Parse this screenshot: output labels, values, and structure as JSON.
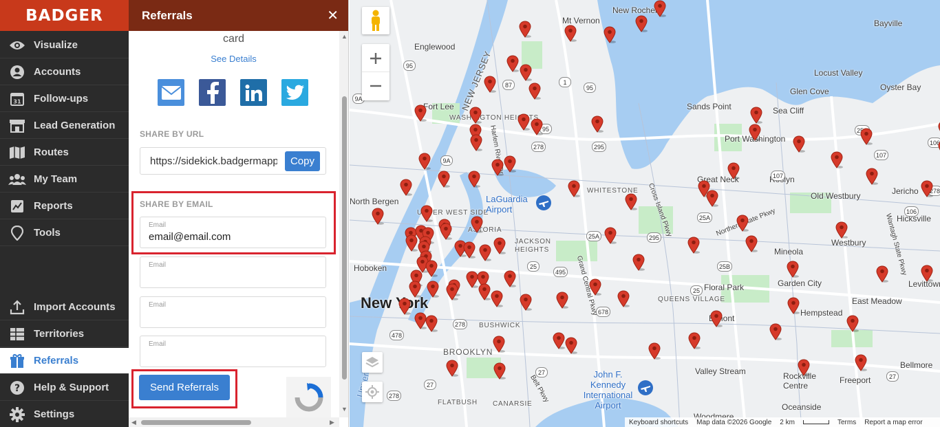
{
  "app": {
    "logo": "BADGER"
  },
  "sidebar": {
    "items": [
      {
        "label": "Visualize",
        "icon": "eye-icon"
      },
      {
        "label": "Accounts",
        "icon": "person-icon"
      },
      {
        "label": "Follow-ups",
        "icon": "calendar-icon"
      },
      {
        "label": "Lead Generation",
        "icon": "store-icon"
      },
      {
        "label": "Routes",
        "icon": "map-icon"
      },
      {
        "label": "My Team",
        "icon": "team-icon"
      },
      {
        "label": "Reports",
        "icon": "chart-icon"
      },
      {
        "label": "Tools",
        "icon": "pin-outline-icon"
      }
    ],
    "bottom_items": [
      {
        "label": "Import Accounts",
        "icon": "upload-icon"
      },
      {
        "label": "Territories",
        "icon": "grid-icon"
      },
      {
        "label": "Referrals",
        "icon": "gift-icon",
        "active": true
      },
      {
        "label": "Help & Support",
        "icon": "help-icon"
      },
      {
        "label": "Settings",
        "icon": "gear-icon"
      }
    ],
    "calendar_day": "31"
  },
  "panel": {
    "title": "Referrals",
    "close": "✕",
    "card_text": "card",
    "see_details": "See Details",
    "share_by_url_label": "SHARE BY URL",
    "url": "https://sidekick.badgermapp",
    "copy_label": "Copy",
    "share_by_email_label": "SHARE BY EMAIL",
    "emails": [
      {
        "placeholder": "Email",
        "value": "email@email.com"
      },
      {
        "placeholder": "Email",
        "value": ""
      },
      {
        "placeholder": "Email",
        "value": ""
      },
      {
        "placeholder": "Email",
        "value": ""
      }
    ],
    "send_label": "Send Referrals"
  },
  "map": {
    "labels": {
      "mt_vernon": "Mt Vernon",
      "new_rochelle": "New Rochelle",
      "bayville": "Bayville",
      "englewood": "Englewood",
      "new_jersey": "NEW JERSEY",
      "locust_valley": "Locust Valley",
      "oyster_bay": "Oyster Bay",
      "glen_cove": "Glen Cove",
      "fort_lee": "Fort Lee",
      "sands_point": "Sands Point",
      "sea_cliff": "Sea Cliff",
      "washington_heights": "WASHINGTON HEIGHTS",
      "port_washington": "Port Washington",
      "great_neck": "Great Neck",
      "roslyn": "Roslyn",
      "jericho": "Jericho",
      "north_bergen": "North Bergen",
      "upper_west_side": "UPPER WEST SIDE",
      "laguardia": "LaGuardia Airport",
      "whitestone": "WHITESTONE",
      "old_westbury": "Old Westbury",
      "astoria": "ASTORIA",
      "hicksville": "Hicksville",
      "jackson_heights": "JACKSON HEIGHTS",
      "mineola": "Mineola",
      "westbury": "Westbury",
      "hoboken": "Hoboken",
      "floral_park": "Floral Park",
      "garden_city": "Garden City",
      "levittown": "Levittown",
      "new_york": "New York",
      "queens_village": "QUEENS VILLAGE",
      "east_meadow": "East Meadow",
      "hempstead": "Hempstead",
      "bushwick": "BUSHWICK",
      "elmont": "Elmont",
      "brooklyn": "BROOKLYN",
      "valley_stream": "Valley Stream",
      "rockville_centre": "Rockville Centre",
      "freeport": "Freeport",
      "bellmore": "Bellmore",
      "jfk": "John F. Kennedy International Airport",
      "flatbush": "FLATBUSH",
      "canarsie": "CANARSIE",
      "oceanside": "Oceanside",
      "woodmere": "Woodmere",
      "upper_bay": "Upper Bay",
      "belt_pkwy": "Belt Pkwy",
      "cross_island_pkwy": "Cross Island Pkwy",
      "northern_state_pkwy": "Northern State Pkwy",
      "wantagh_state_pkwy": "Wantagh State Pkwy",
      "harlem_river_dr": "Harlem River Dr",
      "grand_central_pkwy": "Grand Central Pkwy"
    },
    "shields": [
      "95",
      "87",
      "1",
      "95",
      "9A",
      "95",
      "278",
      "295",
      "25A",
      "25",
      "495",
      "278",
      "678",
      "25A",
      "295",
      "25B",
      "25",
      "107",
      "25A",
      "106",
      "27",
      "278",
      "478",
      "27",
      "27",
      "9A",
      "278",
      "107",
      "106"
    ],
    "footer": {
      "shortcuts": "Keyboard shortcuts",
      "map_data": "Map data ©2026 Google",
      "scale": "2 km",
      "terms": "Terms",
      "report": "Report a map error"
    },
    "pin_color": "#d63a2a",
    "water_color": "#a7cdf2",
    "park_color": "#c8ecc8"
  }
}
